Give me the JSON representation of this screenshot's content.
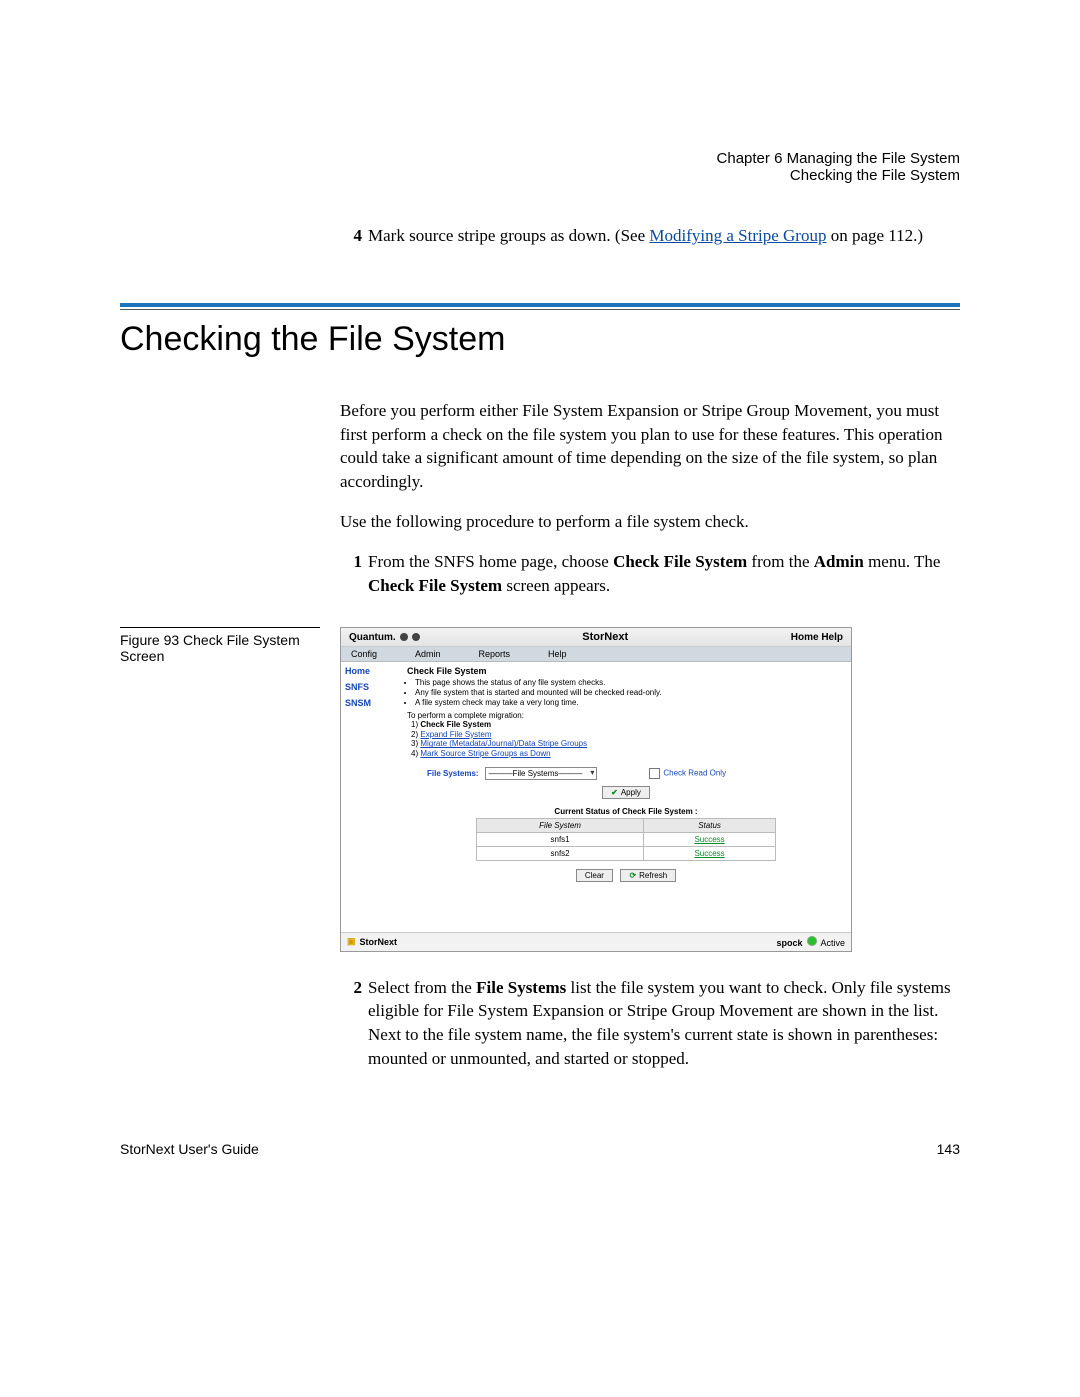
{
  "header": {
    "chapter": "Chapter 6  Managing the File System",
    "subtitle": "Checking the File System"
  },
  "prestep": {
    "num": "4",
    "text_a": "Mark source stripe groups as down. (See ",
    "link": "Modifying a Stripe Group",
    "text_b": " on page  112.)"
  },
  "section_title": "Checking the File System",
  "para1": "Before you perform either File System Expansion or Stripe Group Movement, you must first perform a check on the file system you plan to use for these features. This operation could take a significant amount of time depending on the size of the file system, so plan accordingly.",
  "para2": "Use the following procedure to perform a file system check.",
  "step1": {
    "num": "1",
    "a": "From the SNFS home page, choose ",
    "b": "Check File System",
    "c": " from the ",
    "d": "Admin",
    "e": " menu. The ",
    "f": "Check File System",
    "g": " screen appears."
  },
  "figure_caption": "Figure 93  Check File System Screen",
  "shot": {
    "brand": "Quantum.",
    "app": "StorNext",
    "toplinks": "Home  Help",
    "menu": [
      "Config",
      "Admin",
      "Reports",
      "Help"
    ],
    "side": {
      "home": "Home",
      "snfs": "SNFS",
      "snsm": "SNSM"
    },
    "cfs_title": "Check File System",
    "bullets": [
      "This page shows the status of any file system checks.",
      "Any file system that is started and mounted will be checked read-only.",
      "A file system check may take a very long time."
    ],
    "mig_intro": "To perform a complete migration:",
    "mig": [
      {
        "n": "1)",
        "t": "Check File System",
        "bold": true
      },
      {
        "n": "2)",
        "t": "Expand File System",
        "link": true
      },
      {
        "n": "3)",
        "t": "Migrate (Metadata/Journal)/Data Stripe Groups",
        "link": true
      },
      {
        "n": "4)",
        "t": "Mark Source Stripe Groups as Down",
        "link": true
      }
    ],
    "fs_label": "File Systems:",
    "fs_value": "———File Systems———",
    "readonly": "Check Read Only",
    "apply": "Apply",
    "status_head": "Current Status of Check File System :",
    "th1": "File System",
    "th2": "Status",
    "rows": [
      {
        "fs": "snfs1",
        "st": "Success"
      },
      {
        "fs": "snfs2",
        "st": "Success"
      }
    ],
    "clear": "Clear",
    "refresh": "Refresh",
    "foot_brand": "StorNext",
    "host": "spock",
    "active": "Active"
  },
  "step2": {
    "num": "2",
    "a": "Select from the ",
    "b": "File Systems",
    "c": " list the file system you want to check. Only file systems eligible for File System Expansion or Stripe Group Movement are shown in the list. Next to the file system name, the file system's current state is shown in parentheses: mounted or unmounted, and started or stopped."
  },
  "footer": {
    "left": "StorNext User's Guide",
    "right": "143"
  }
}
